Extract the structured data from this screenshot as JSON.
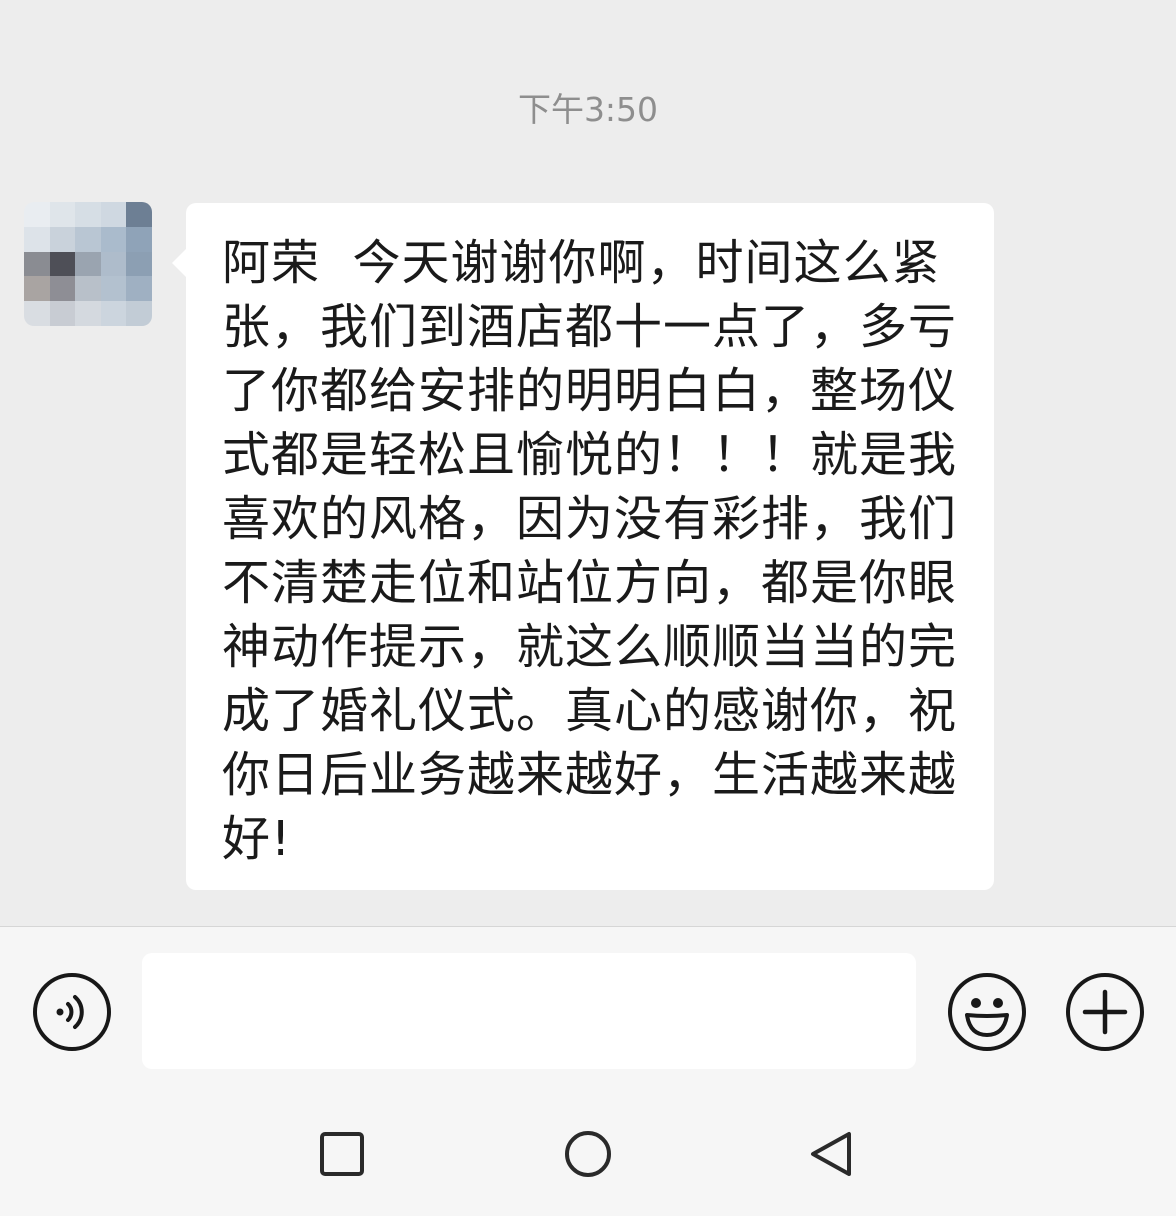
{
  "chat": {
    "timestamp": "下午3:50",
    "message": {
      "text": "阿荣  今天谢谢你啊，时间这么紧张，我们到酒店都十一点了，多亏了你都给安排的明明白白，整场仪式都是轻松且愉悦的！！！就是我喜欢的风格，因为没有彩排，我们不清楚走位和站位方向，都是你眼神动作提示，就这么顺顺当当的完成了婚礼仪式。真心的感谢你，祝你日后业务越来越好，生活越来越好!"
    }
  },
  "input_bar": {
    "voice_icon": "voice-icon",
    "text_value": "",
    "emoji_icon": "smiley-icon",
    "plus_icon": "plus-icon"
  },
  "nav": {
    "recent_icon": "square-icon",
    "home_icon": "circle-icon",
    "back_icon": "triangle-back-icon"
  },
  "colors": {
    "chat_bg": "#ededed",
    "bubble_bg": "#ffffff",
    "timestamp": "#8e8e8e",
    "text": "#1a1a1a"
  }
}
